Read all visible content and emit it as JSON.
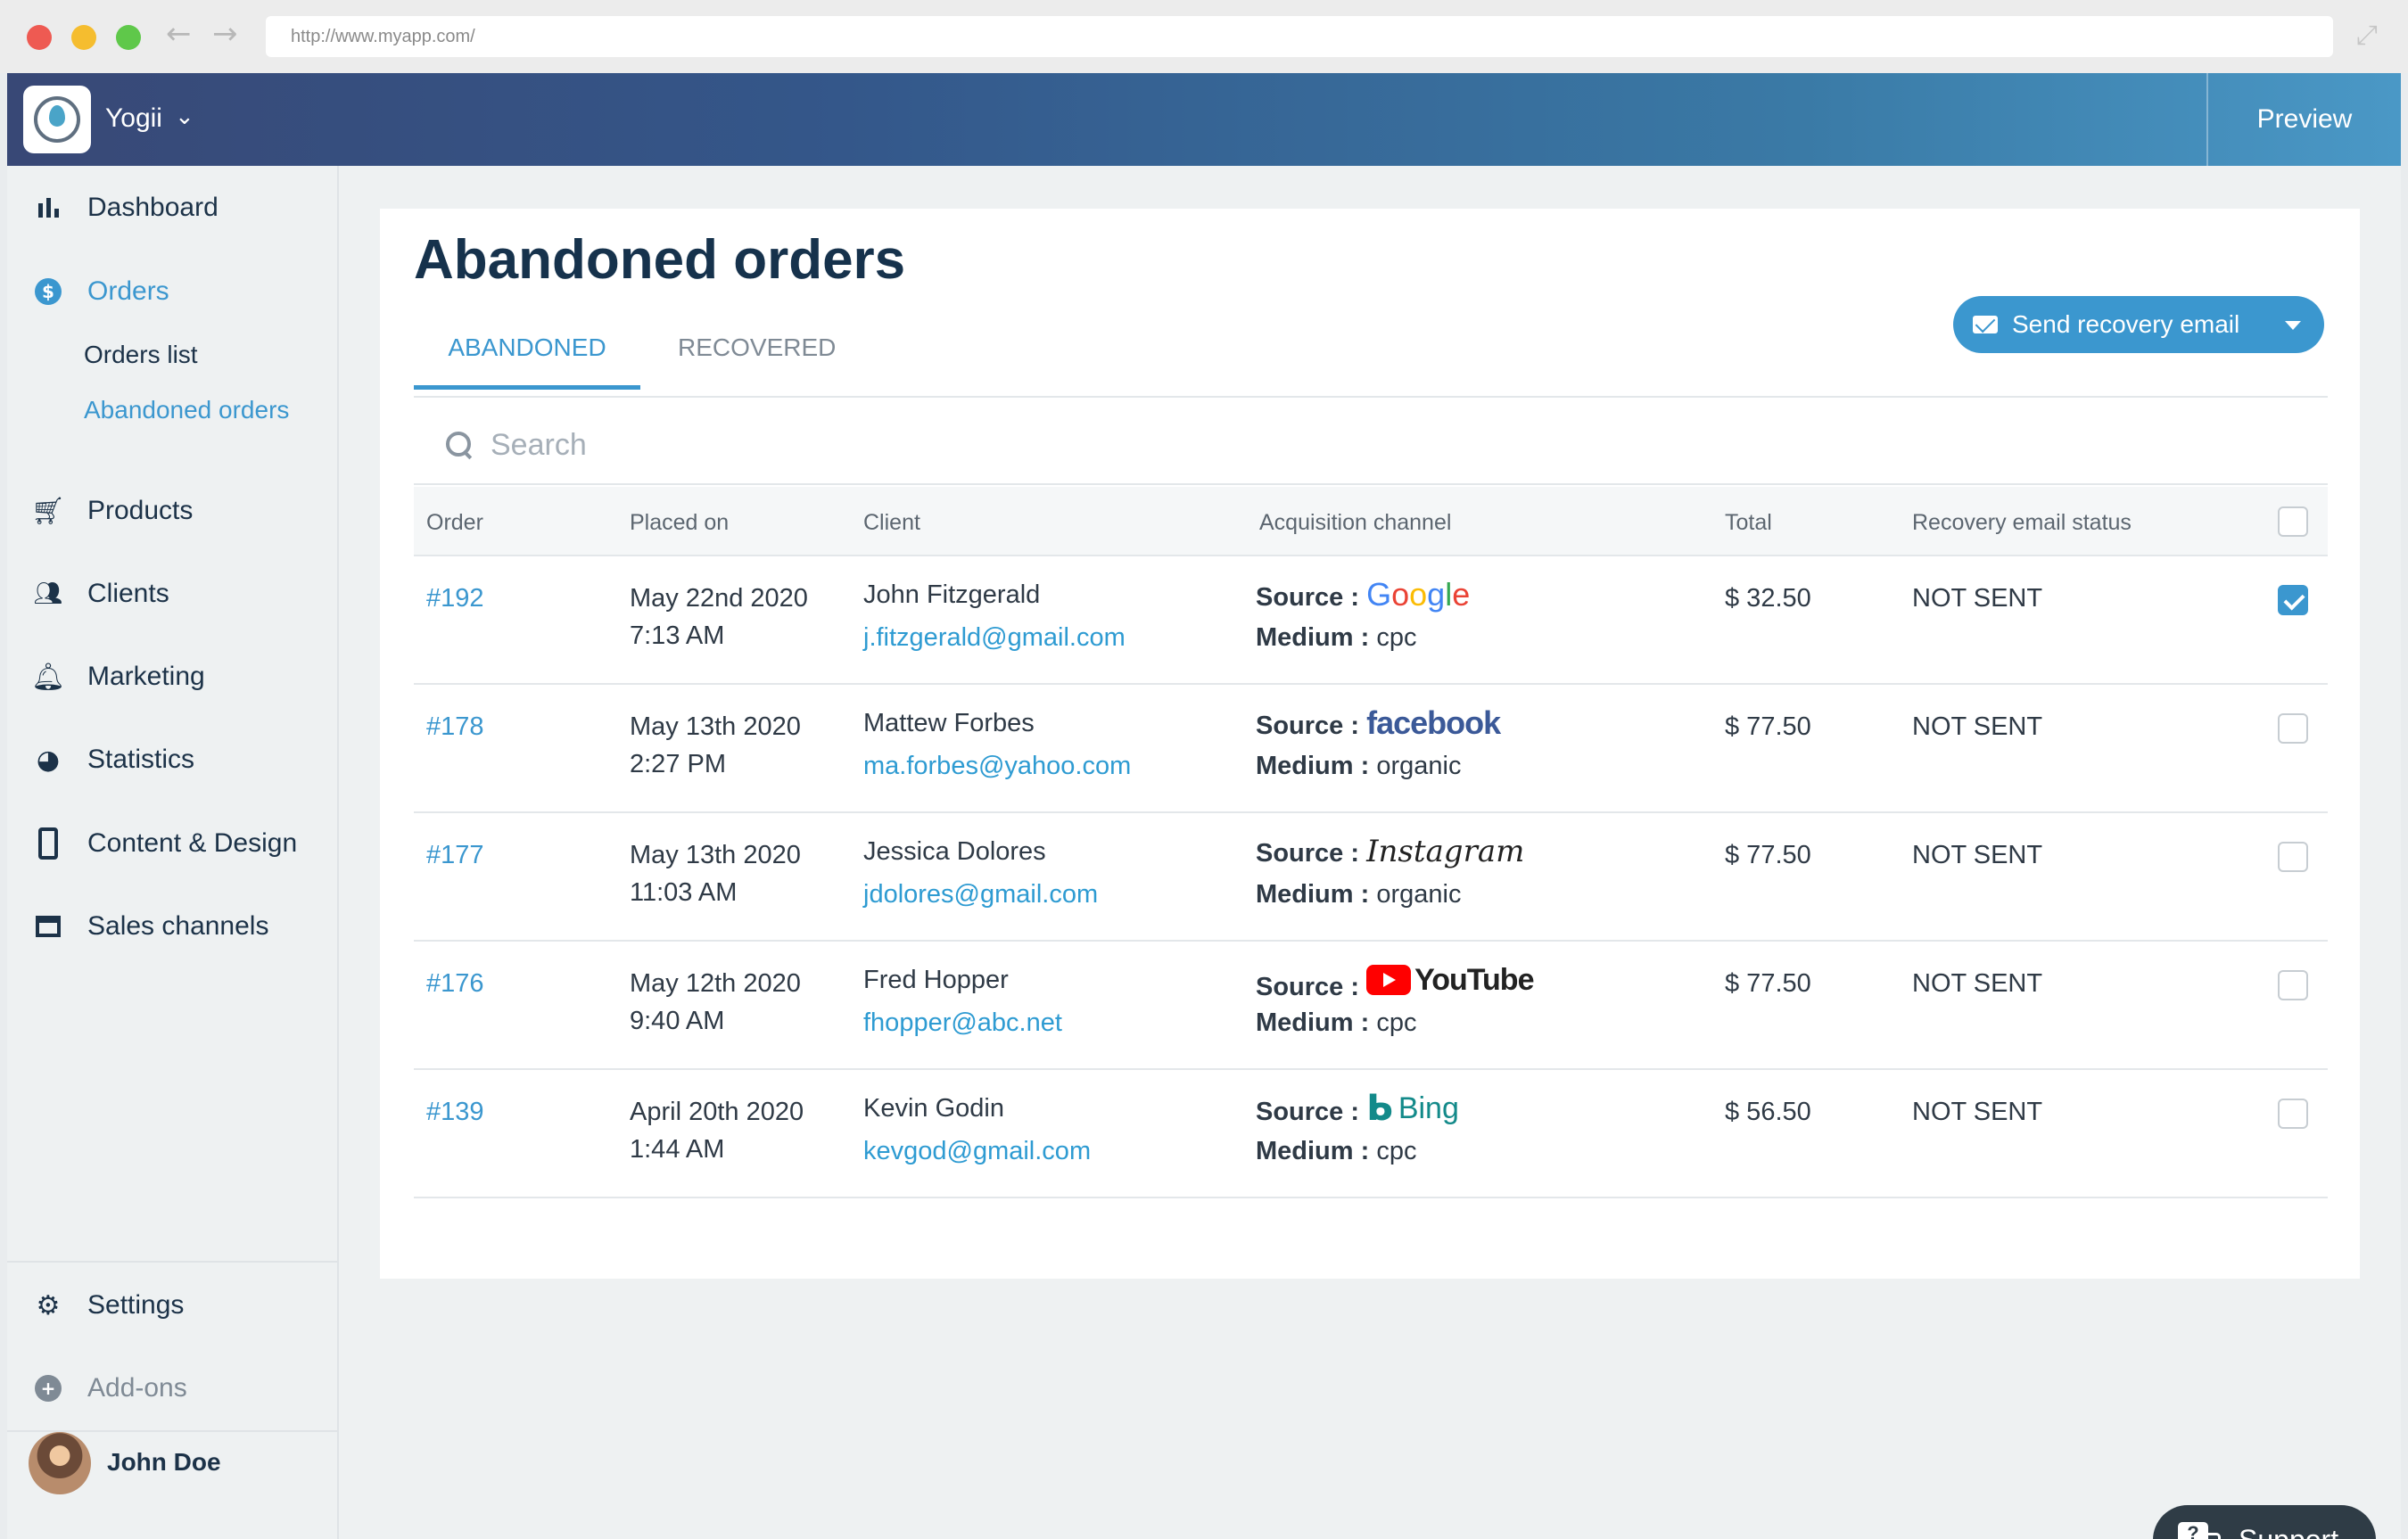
{
  "browser": {
    "url": "http://www.myapp.com/"
  },
  "header": {
    "brand": "Yogii",
    "preview_label": "Preview"
  },
  "sidebar": {
    "items": [
      {
        "label": "Dashboard",
        "icon": "bar-chart-icon"
      },
      {
        "label": "Orders",
        "icon": "dollar-circle-icon"
      },
      {
        "label": "Products",
        "icon": "cart-icon"
      },
      {
        "label": "Clients",
        "icon": "people-icon"
      },
      {
        "label": "Marketing",
        "icon": "bell-icon"
      },
      {
        "label": "Statistics",
        "icon": "pie-chart-icon"
      },
      {
        "label": "Content & Design",
        "icon": "phone-icon"
      },
      {
        "label": "Sales channels",
        "icon": "store-icon"
      }
    ],
    "sub_items": [
      "Orders list",
      "Abandoned orders"
    ],
    "bottom_items": [
      {
        "label": "Settings",
        "icon": "gear-icon"
      },
      {
        "label": "Add-ons",
        "icon": "plus-circle-icon"
      }
    ],
    "user_name": "John Doe"
  },
  "page": {
    "title": "Abandoned orders",
    "tabs": [
      "ABANDONED",
      "RECOVERED"
    ],
    "send_button_label": "Send recovery email",
    "search_placeholder": "Search"
  },
  "table": {
    "columns": [
      "Order",
      "Placed on",
      "Client",
      "Acquisition channel",
      "Total",
      "Recovery email status"
    ],
    "source_prefix": "Source :",
    "medium_prefix": "Medium :",
    "rows": [
      {
        "order": "#192",
        "date": "May 22nd 2020",
        "time": "7:13 AM",
        "client": "John Fitzgerald",
        "email": "j.fitzgerald@gmail.com",
        "source": "Google",
        "medium": "cpc",
        "total": "$ 32.50",
        "status": "NOT SENT",
        "checked": true
      },
      {
        "order": "#178",
        "date": "May 13th 2020",
        "time": "2:27 PM",
        "client": "Mattew Forbes",
        "email": "ma.forbes@yahoo.com",
        "source": "facebook",
        "medium": "organic",
        "total": "$ 77.50",
        "status": "NOT SENT",
        "checked": false
      },
      {
        "order": "#177",
        "date": "May 13th 2020",
        "time": "11:03 AM",
        "client": "Jessica Dolores",
        "email": "jdolores@gmail.com",
        "source": "Instagram",
        "medium": "organic",
        "total": "$ 77.50",
        "status": "NOT SENT",
        "checked": false
      },
      {
        "order": "#176",
        "date": "May 12th 2020",
        "time": "9:40 AM",
        "client": "Fred Hopper",
        "email": "fhopper@abc.net",
        "source": "YouTube",
        "medium": "cpc",
        "total": "$ 77.50",
        "status": "NOT SENT",
        "checked": false
      },
      {
        "order": "#139",
        "date": "April 20th 2020",
        "time": "1:44 AM",
        "client": "Kevin Godin",
        "email": "kevgod@gmail.com",
        "source": "Bing",
        "medium": "cpc",
        "total": "$ 56.50",
        "status": "NOT SENT",
        "checked": false
      }
    ]
  },
  "support_label": "Support",
  "colors": {
    "accent": "#3b97cf",
    "navy": "#16324c",
    "support_bg": "#2f3c46"
  }
}
